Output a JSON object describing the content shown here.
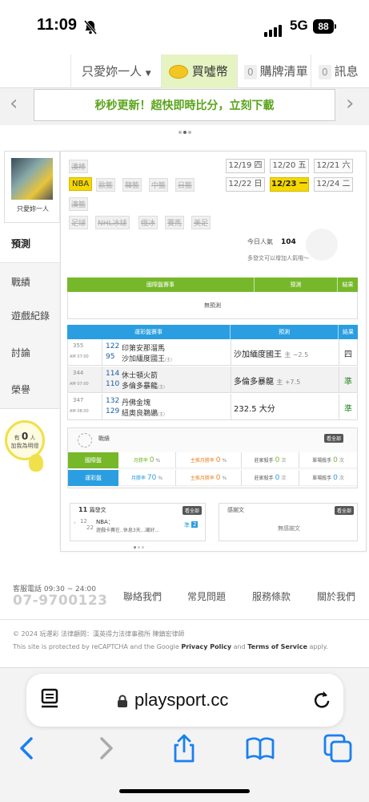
{
  "status_bar": {
    "time": "11:09",
    "network": "5G",
    "battery": "88"
  },
  "top_nav": {
    "user_name": "只愛妳一人",
    "coin_label": "買噓幣",
    "cart_count": "0",
    "cart_label": "購牌清單",
    "msg_count": "0",
    "msg_label": "訊息"
  },
  "promo": {
    "text": "秒秒更新！超快即時比分，立刻下載"
  },
  "profile": {
    "name": "只愛妳一人"
  },
  "left_tabs": [
    "預測",
    "戰績",
    "遊戲紀錄",
    "討論",
    "榮譽"
  ],
  "fans": {
    "prefix": "有",
    "count": "0",
    "unit": "人",
    "line2": "加我為明燈"
  },
  "leagues": {
    "row1": [
      "澳棒"
    ],
    "row2": [
      "NBA",
      "歐籃",
      "韓籃",
      "中籃",
      "日籃"
    ],
    "row3": [
      "澳籃"
    ],
    "row4": [
      "足球",
      "NHL冰球",
      "俄冰",
      "賽馬",
      "美足"
    ]
  },
  "dates": [
    [
      "12/19 四",
      "12/20 五",
      "12/21 六"
    ],
    [
      "12/22 日",
      "12/23 一",
      "12/24 二"
    ]
  ],
  "popularity": {
    "label": "今日人氣",
    "value": "104",
    "hint": "多發文可以增加人氣哦～"
  },
  "intl_table": {
    "headers": [
      "國際盤賽事",
      "預測",
      "結果"
    ],
    "empty": "無預測"
  },
  "lottery_table": {
    "headers": [
      "運彩盤賽事",
      "預測",
      "結果"
    ],
    "rows": [
      {
        "id": "355",
        "time": "AM 07:00",
        "away_num": "122",
        "away": "印第安那溜馬",
        "home_num": "95",
        "home": "沙加緬度國王",
        "home_tag": "(主)",
        "pick": "沙加緬度國王",
        "pick_sub": "主 −2.5",
        "result": "四",
        "result_color": "#333"
      },
      {
        "id": "344",
        "time": "AM 07:00",
        "away_num": "114",
        "away": "休士頓火箭",
        "home_num": "110",
        "home": "多倫多暴龍",
        "home_tag": "(主)",
        "pick": "多倫多暴龍",
        "pick_sub": "主 +7.5",
        "result": "準",
        "result_color": "#2a8a2a"
      },
      {
        "id": "347",
        "time": "AM 08:00",
        "away_num": "132",
        "away": "丹佛金塊",
        "home_num": "129",
        "home": "紐奧良鵜鶘",
        "home_tag": "(主)",
        "pick": "232.5 大分",
        "pick_sub": "",
        "result": "準",
        "result_color": "#2a8a2a"
      }
    ]
  },
  "record": {
    "title": "戰績",
    "all_btn": "看全部",
    "rows": [
      {
        "label": "國際盤",
        "color": "#76b82a",
        "win": "月勝率",
        "win_val": "0",
        "win_unit": "%",
        "main": "主推月勝率",
        "main_val": "0",
        "main_unit": "%",
        "house": "莊家殺手",
        "house_val": "0",
        "house_unit": "次",
        "single": "單場殺手",
        "single_val": "0",
        "single_unit": "次"
      },
      {
        "label": "運彩盤",
        "color": "#2a9ee0",
        "win": "月勝率",
        "win_val": "70",
        "win_unit": "%",
        "main": "主推月勝率",
        "main_val": "0",
        "main_unit": "%",
        "house": "莊家殺手",
        "house_val": "0",
        "house_unit": "次",
        "single": "單場殺手",
        "single_val": "0",
        "single_unit": "次"
      }
    ]
  },
  "posts": {
    "count": "11",
    "label": "篇發文",
    "all_btn": "看全部",
    "item_month": "12",
    "item_day": "22",
    "item_league": "NBA：",
    "item_text": "遊戲卡賽在..休息3天...讓好...",
    "item_tag": "準",
    "item_num": "2"
  },
  "thanks": {
    "label": "感謝文",
    "all_btn": "看全部",
    "empty": "無感謝文"
  },
  "footer": {
    "phone_label": "客服電話 09:30 ~ 24:00",
    "phone": "07-9700123",
    "links": [
      "聯絡我們",
      "常見問題",
      "服務條款",
      "關於我們"
    ],
    "copyright": "© 2024 玩運彩 法律顧問：漢英得力法律事務所 陳鎮宏律師",
    "captcha_pre": "This site is protected by reCAPTCHA and the Google",
    "privacy": "Privacy Policy",
    "and": "and",
    "terms": "Terms of Service",
    "apply": "apply."
  },
  "browser": {
    "url": "playsport.cc"
  }
}
